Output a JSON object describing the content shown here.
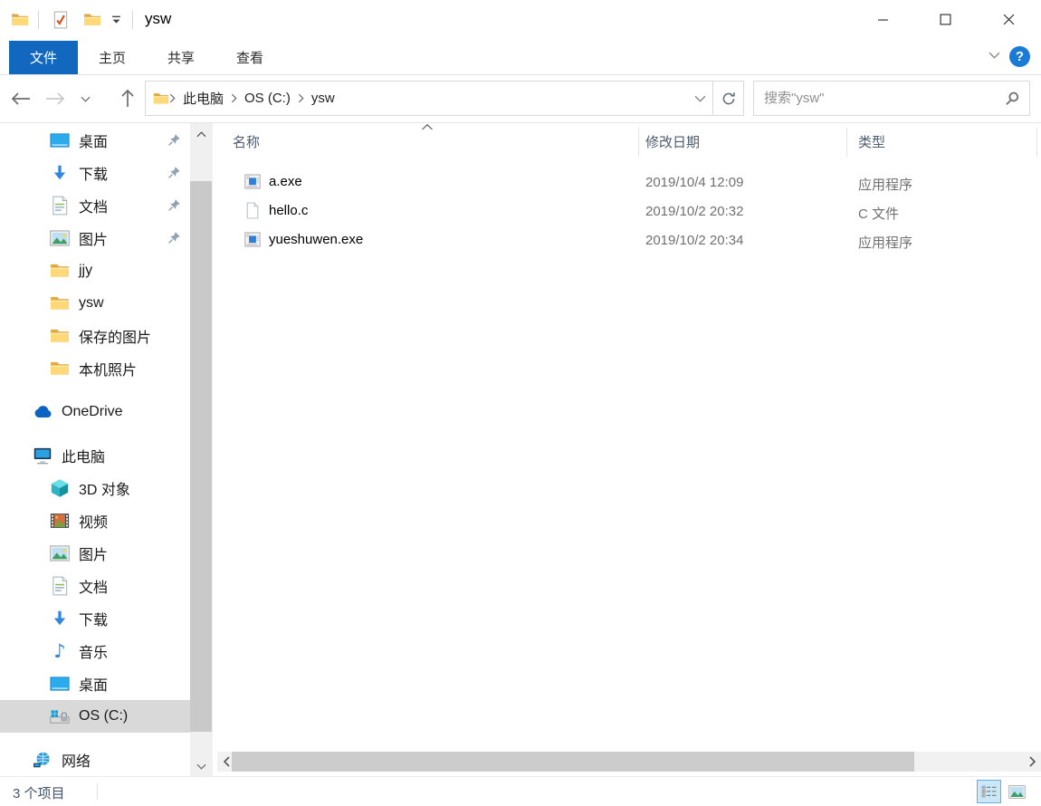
{
  "window": {
    "title": "ysw"
  },
  "ribbon": {
    "tabs": [
      {
        "id": "file",
        "label": "文件",
        "active": true
      },
      {
        "id": "home",
        "label": "主页",
        "active": false
      },
      {
        "id": "share",
        "label": "共享",
        "active": false
      },
      {
        "id": "view",
        "label": "查看",
        "active": false
      }
    ],
    "help_glyph": "?"
  },
  "toolbar": {
    "breadcrumb": {
      "crumbs": [
        "此电脑",
        "OS (C:)",
        "ysw"
      ]
    },
    "search": {
      "placeholder": "搜索\"ysw\""
    }
  },
  "filelist": {
    "columns": [
      {
        "id": "name",
        "label": "名称",
        "sorted": "asc"
      },
      {
        "id": "date",
        "label": "修改日期"
      },
      {
        "id": "type",
        "label": "类型"
      }
    ],
    "rows": [
      {
        "icon": "exe",
        "name": "a.exe",
        "date": "2019/10/4 12:09",
        "type": "应用程序"
      },
      {
        "icon": "cfile",
        "name": "hello.c",
        "date": "2019/10/2 20:32",
        "type": "C 文件"
      },
      {
        "icon": "exe",
        "name": "yueshuwen.exe",
        "date": "2019/10/2 20:34",
        "type": "应用程序"
      }
    ]
  },
  "sidebar": {
    "sections": [
      {
        "id": "quick-access",
        "items": [
          {
            "id": "desktop-pinned",
            "label": "桌面",
            "icon": "desktop",
            "level": 1,
            "pinned": true
          },
          {
            "id": "downloads-pinned",
            "label": "下载",
            "icon": "download",
            "level": 1,
            "pinned": true
          },
          {
            "id": "documents-pinned",
            "label": "文档",
            "icon": "documents",
            "level": 1,
            "pinned": true
          },
          {
            "id": "pictures-pinned",
            "label": "图片",
            "icon": "pictures",
            "level": 1,
            "pinned": true
          },
          {
            "id": "jjy",
            "label": "jjy",
            "icon": "folder",
            "level": 1
          },
          {
            "id": "ysw",
            "label": "ysw",
            "icon": "folder",
            "level": 1
          },
          {
            "id": "saved-pictures",
            "label": "保存的图片",
            "icon": "folder",
            "level": 1
          },
          {
            "id": "camera-roll",
            "label": "本机照片",
            "icon": "folder",
            "level": 1
          }
        ]
      },
      {
        "id": "onedrive",
        "items": [
          {
            "id": "onedrive",
            "label": "OneDrive",
            "icon": "onedrive",
            "level": 0
          }
        ]
      },
      {
        "id": "this-pc",
        "items": [
          {
            "id": "this-pc",
            "label": "此电脑",
            "icon": "pc",
            "level": 0
          },
          {
            "id": "3d-objects",
            "label": "3D 对象",
            "icon": "cube",
            "level": 1
          },
          {
            "id": "videos",
            "label": "视频",
            "icon": "video",
            "level": 1
          },
          {
            "id": "pictures",
            "label": "图片",
            "icon": "pictures",
            "level": 1
          },
          {
            "id": "documents",
            "label": "文档",
            "icon": "documents",
            "level": 1
          },
          {
            "id": "downloads",
            "label": "下载",
            "icon": "download",
            "level": 1
          },
          {
            "id": "music",
            "label": "音乐",
            "icon": "music",
            "level": 1
          },
          {
            "id": "desktop",
            "label": "桌面",
            "icon": "desktop",
            "level": 1
          },
          {
            "id": "os-c",
            "label": "OS (C:)",
            "icon": "drive",
            "level": 1,
            "selected": true
          }
        ]
      },
      {
        "id": "network",
        "items": [
          {
            "id": "network",
            "label": "网络",
            "icon": "network",
            "level": 0
          }
        ]
      }
    ]
  },
  "statusbar": {
    "items_count": "3 个项目"
  },
  "colors": {
    "accent_blue": "#1267bf",
    "help_blue": "#1a7ad4",
    "selection_grey": "#d9d9d9"
  }
}
